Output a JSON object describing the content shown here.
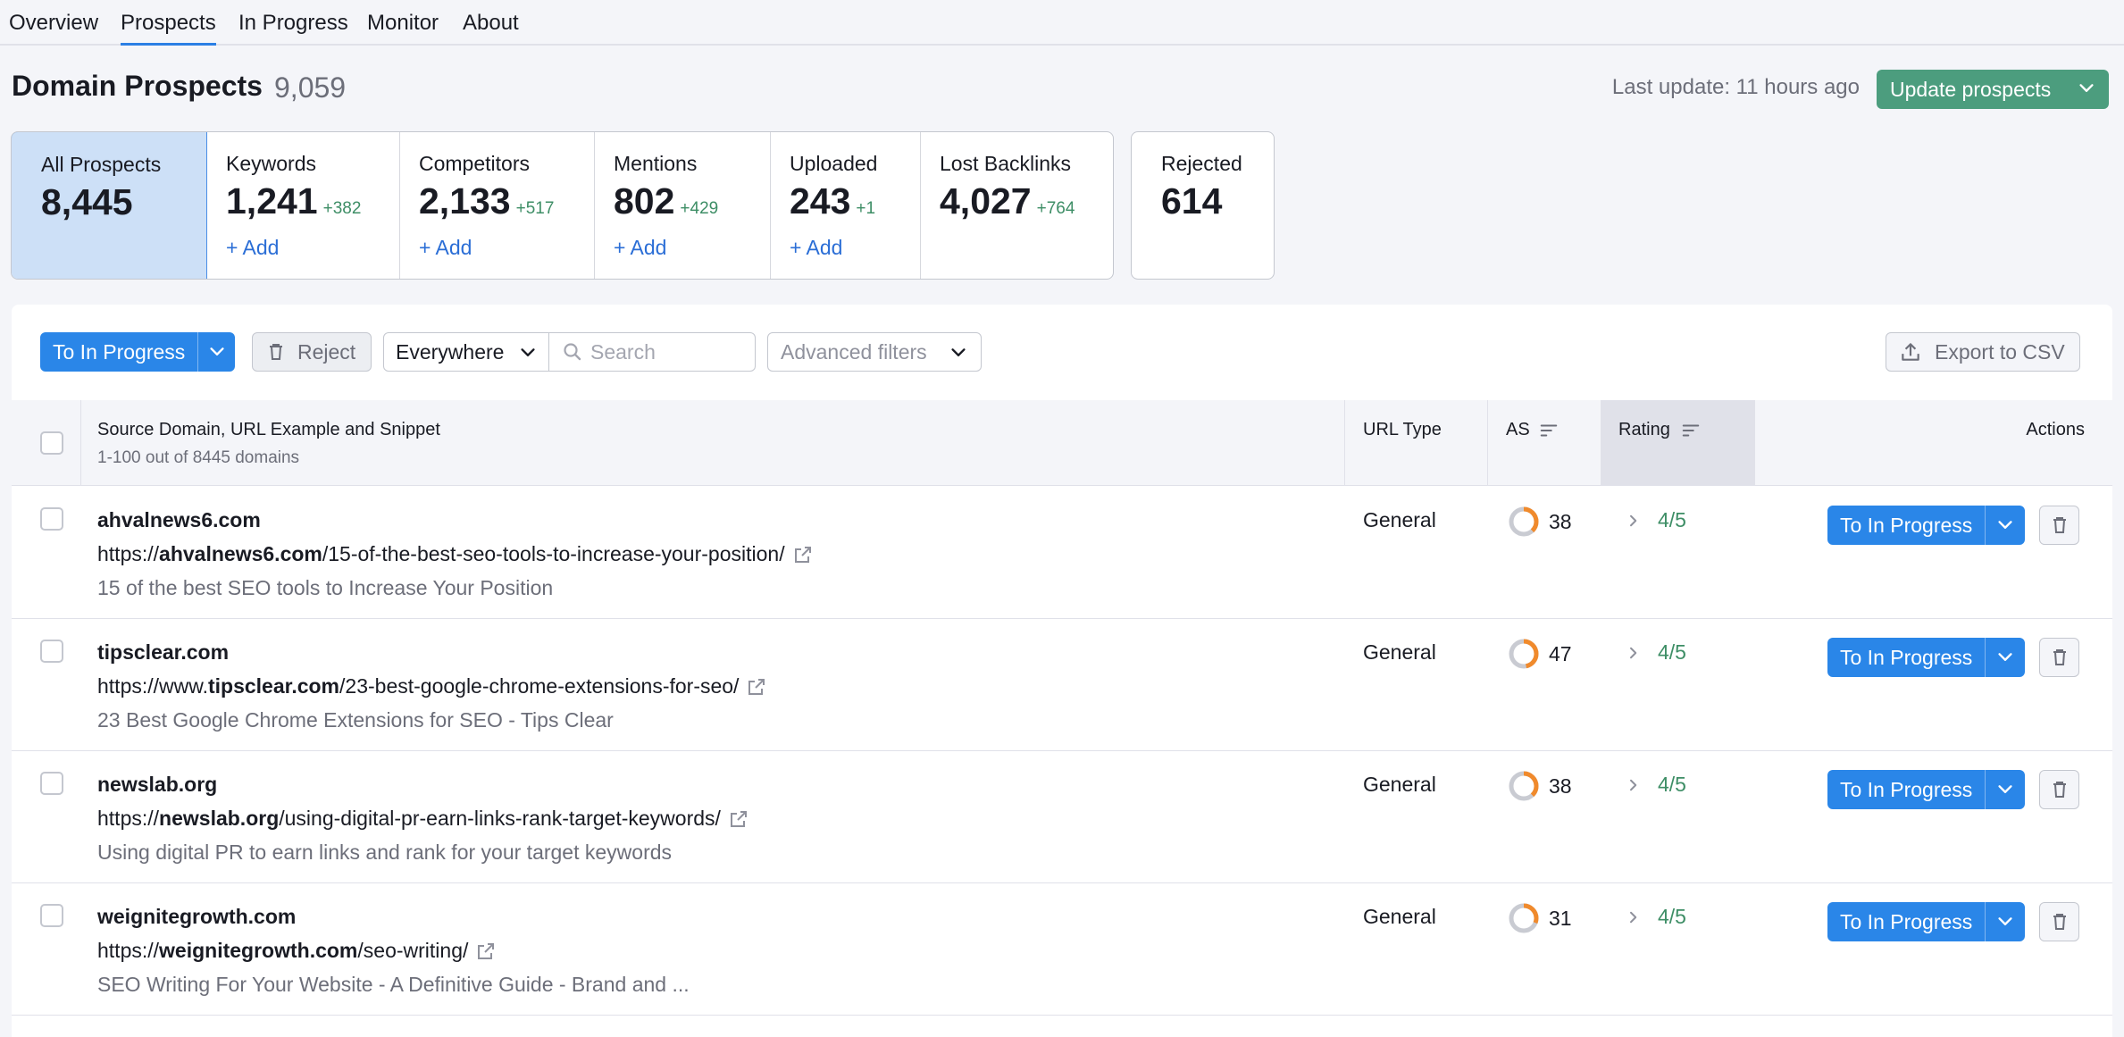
{
  "nav": {
    "tabs": [
      {
        "label": "Overview"
      },
      {
        "label": "Prospects"
      },
      {
        "label": "In Progress"
      },
      {
        "label": "Monitor"
      },
      {
        "label": "About"
      }
    ],
    "active": "Prospects"
  },
  "header": {
    "title": "Domain Prospects",
    "count": "9,059",
    "last_update": "Last update: 11 hours ago",
    "update_button": "Update prospects"
  },
  "cards": [
    {
      "label": "All Prospects",
      "value": "8,445",
      "delta": "",
      "add": ""
    },
    {
      "label": "Keywords",
      "value": "1,241",
      "delta": "+382",
      "add": "+ Add"
    },
    {
      "label": "Competitors",
      "value": "2,133",
      "delta": "+517",
      "add": "+ Add"
    },
    {
      "label": "Mentions",
      "value": "802",
      "delta": "+429",
      "add": "+ Add"
    },
    {
      "label": "Uploaded",
      "value": "243",
      "delta": "+1",
      "add": "+ Add"
    },
    {
      "label": "Lost Backlinks",
      "value": "4,027",
      "delta": "+764",
      "add": ""
    }
  ],
  "rejected": {
    "label": "Rejected",
    "value": "614"
  },
  "toolbar": {
    "to_in_progress": "To In Progress",
    "reject": "Reject",
    "scope": "Everywhere",
    "search_placeholder": "Search",
    "advanced_filters": "Advanced filters",
    "export": "Export to CSV"
  },
  "table": {
    "col_source": "Source Domain, URL Example and Snippet",
    "col_source_sub": "1-100 out of 8445 domains",
    "col_urltype": "URL Type",
    "col_as": "AS",
    "col_rating": "Rating",
    "col_actions": "Actions",
    "action_label": "To In Progress",
    "rows": [
      {
        "domain": "ahvalnews6.com",
        "url_prefix": "https://",
        "url_domain": "ahvalnews6.com",
        "url_path": "/15-of-the-best-seo-tools-to-increase-your-position/",
        "snippet": "15 of the best SEO tools to Increase Your Position",
        "url_type": "General",
        "as": "38",
        "rating": "4/5"
      },
      {
        "domain": "tipsclear.com",
        "url_prefix": "https://www.",
        "url_domain": "tipsclear.com",
        "url_path": "/23-best-google-chrome-extensions-for-seo/",
        "snippet": "23 Best Google Chrome Extensions for SEO - Tips Clear",
        "url_type": "General",
        "as": "47",
        "rating": "4/5"
      },
      {
        "domain": "newslab.org",
        "url_prefix": "https://",
        "url_domain": "newslab.org",
        "url_path": "/using-digital-pr-earn-links-rank-target-keywords/",
        "snippet": "Using digital PR to earn links and rank for your target keywords",
        "url_type": "General",
        "as": "38",
        "rating": "4/5"
      },
      {
        "domain": "weignitegrowth.com",
        "url_prefix": "https://",
        "url_domain": "weignitegrowth.com",
        "url_path": "/seo-writing/",
        "snippet": "SEO Writing For Your Website - A Definitive Guide - Brand and ...",
        "url_type": "General",
        "as": "31",
        "rating": "4/5"
      }
    ]
  },
  "colors": {
    "accent_blue": "#2a86e8",
    "accent_green": "#4c9d7e",
    "delta_green": "#3e8e66",
    "gauge_orange": "#f08a2c"
  }
}
